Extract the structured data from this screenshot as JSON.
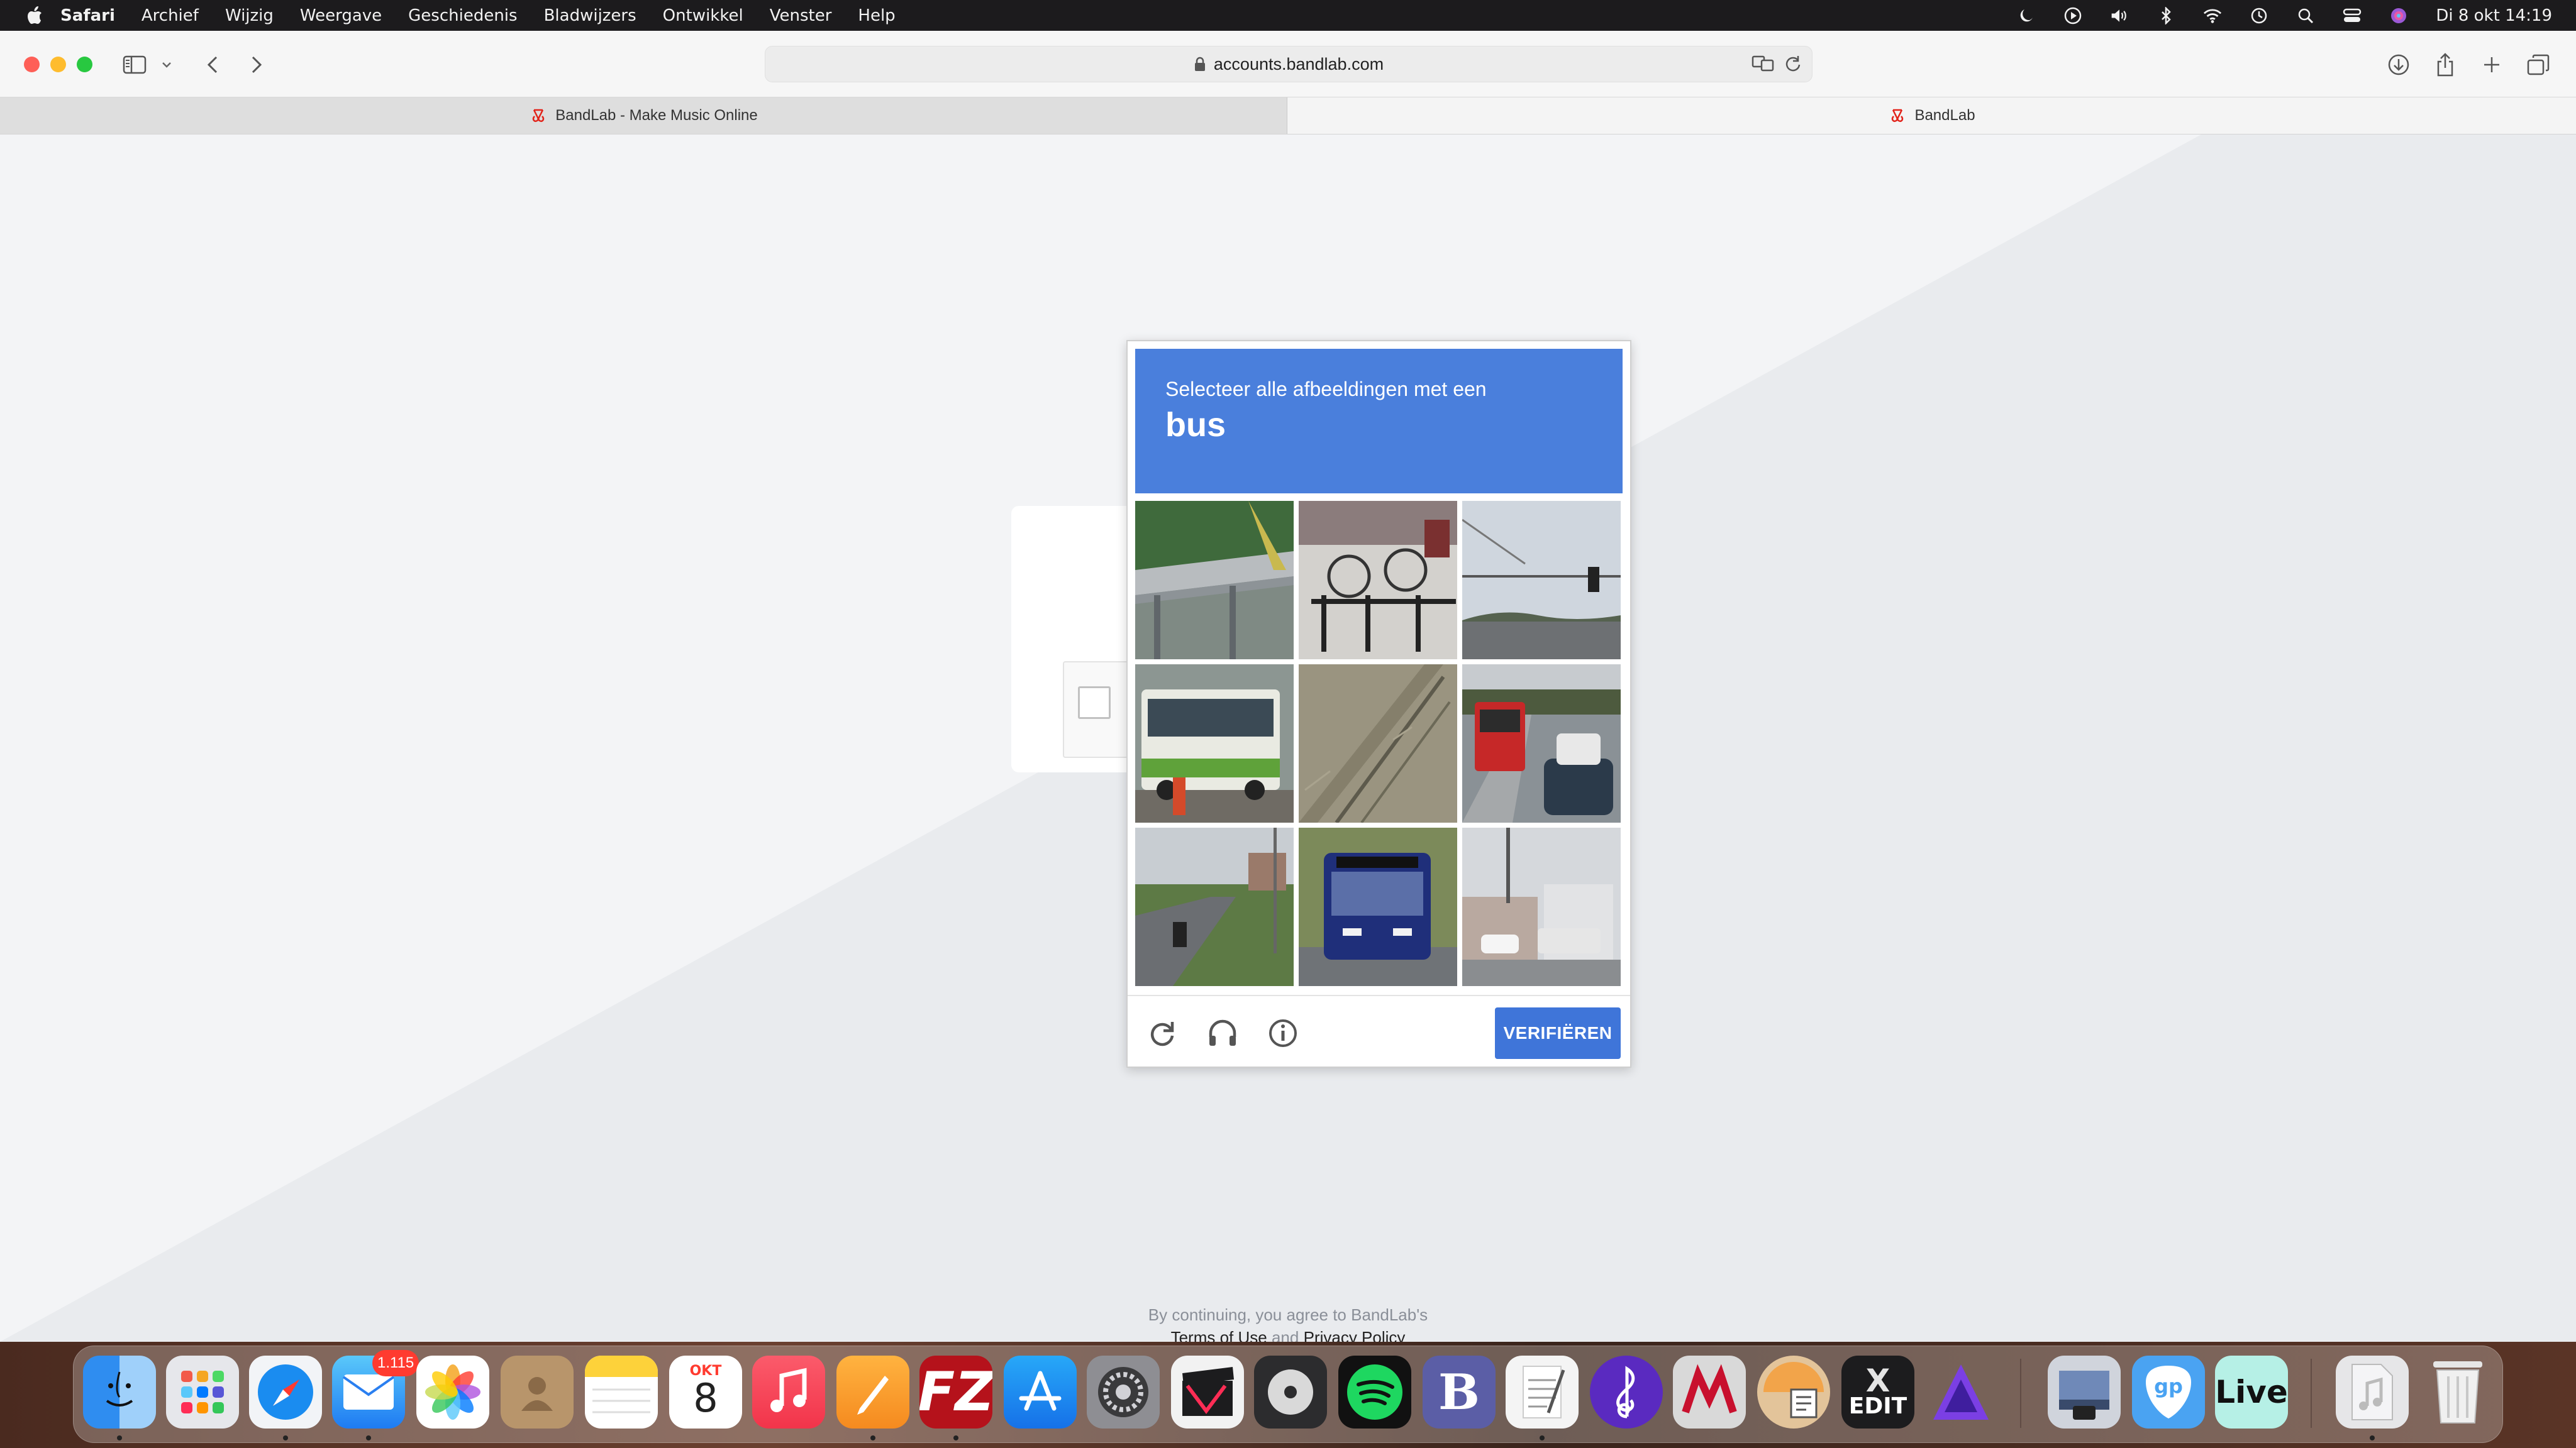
{
  "menubar": {
    "app_name": "Safari",
    "items": [
      "Archief",
      "Wijzig",
      "Weergave",
      "Geschiedenis",
      "Bladwijzers",
      "Ontwikkel",
      "Venster",
      "Help"
    ],
    "clock": "Di 8 okt  14:19",
    "status_icons": [
      "moon-icon",
      "play-icon",
      "volume-icon",
      "bluetooth-icon",
      "wifi-icon",
      "time-machine-icon",
      "search-icon",
      "control-center-icon",
      "siri-icon"
    ]
  },
  "browser": {
    "url": "accounts.bandlab.com",
    "tabs": [
      {
        "label": "BandLab - Make Music Online",
        "active": false
      },
      {
        "label": "BandLab",
        "active": true
      }
    ]
  },
  "captcha": {
    "instruction": "Selecteer alle afbeeldingen met een",
    "object": "bus",
    "verify_label": "VERIFIËREN",
    "tiles": [
      "guardrail",
      "bicycles",
      "traffic-light",
      "bus-green",
      "grass",
      "bus-red",
      "road-motorbike",
      "bus-blue",
      "street"
    ],
    "colors": {
      "header": "#4a7fdc",
      "button": "#3f75d9"
    }
  },
  "legal": {
    "line1": "By continuing, you agree to BandLab's",
    "terms": "Terms of Use",
    "and": "and",
    "privacy": "Privacy Policy"
  },
  "dock": {
    "mail_badge": "1.115",
    "calendar_month": "OKT",
    "calendar_day": "8",
    "xedit_label": "EDIT",
    "live_label": "Live"
  }
}
